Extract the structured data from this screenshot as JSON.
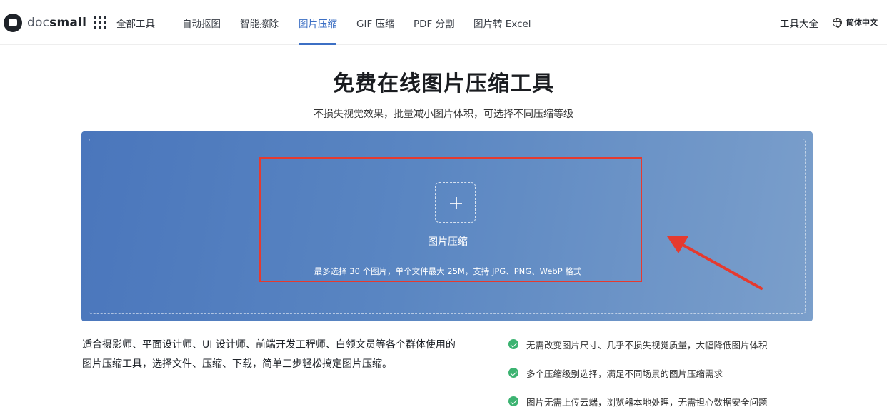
{
  "header": {
    "logo_doc": "doc",
    "logo_small": "small",
    "all_tools": "全部工具",
    "nav": [
      {
        "label": "自动抠图",
        "active": false
      },
      {
        "label": "智能擦除",
        "active": false
      },
      {
        "label": "图片压缩",
        "active": true
      },
      {
        "label": "GIF 压缩",
        "active": false
      },
      {
        "label": "PDF 分割",
        "active": false
      },
      {
        "label": "图片转 Excel",
        "active": false
      }
    ],
    "tools_all": "工具大全",
    "language": "简体中文"
  },
  "hero": {
    "title": "免费在线图片压缩工具",
    "subtitle": "不损失视觉效果，批量减小图片体积，可选择不同压缩等级"
  },
  "upload": {
    "label": "图片压缩",
    "hint": "最多选择 30 个图片，单个文件最大 25M，支持 JPG、PNG、WebP 格式"
  },
  "description": "适合摄影师、平面设计师、UI 设计师、前端开发工程师、白领文员等各个群体使用的图片压缩工具，选择文件、压缩、下载，简单三步轻松搞定图片压缩。",
  "features": [
    "无需改变图片尺寸、几乎不损失视觉质量，大幅降低图片体积",
    "多个压缩级别选择，满足不同场景的图片压缩需求",
    "图片无需上传云端，浏览器本地处理，无需担心数据安全问题"
  ],
  "colors": {
    "accent": "#3c6fc4",
    "panel_start": "#4a76bc",
    "panel_end": "#7b9fcb",
    "highlight_red": "#e53a2f",
    "check_green": "#3cb371"
  }
}
